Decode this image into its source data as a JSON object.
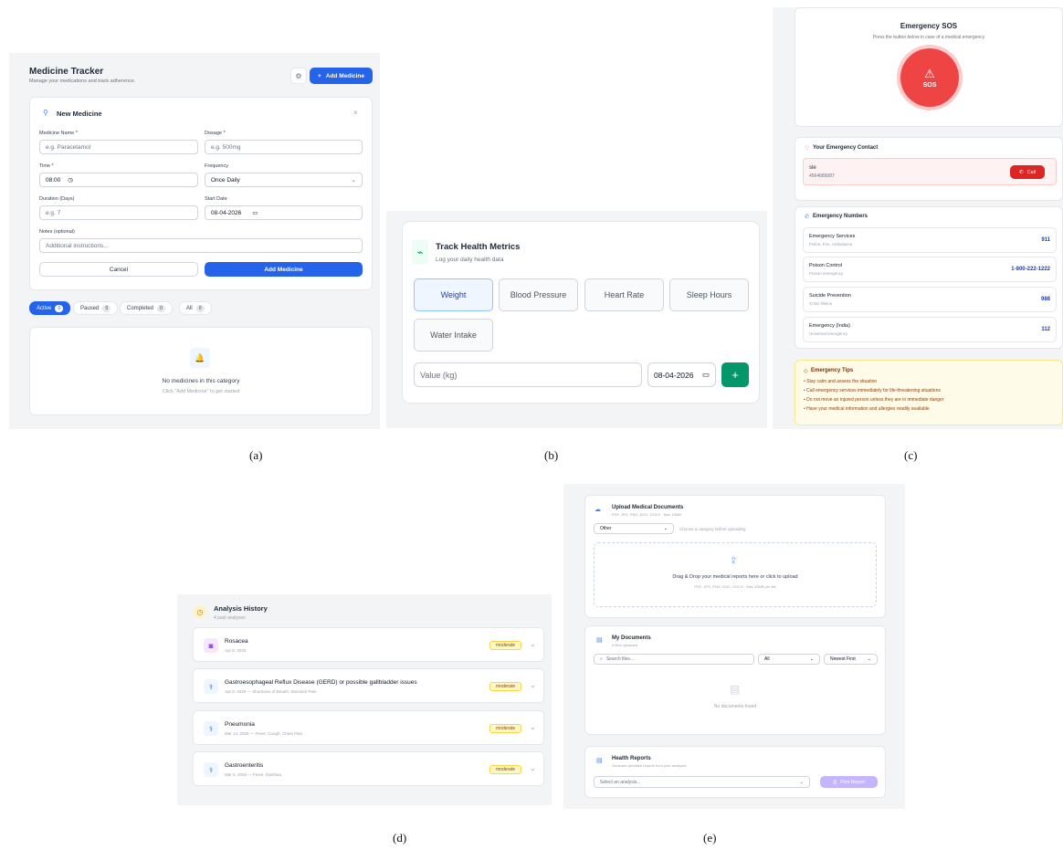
{
  "captions": [
    "(a)",
    "(b)",
    "(c)",
    "(d)",
    "(e)"
  ],
  "medicine": {
    "title": "Medicine Tracker",
    "subtitle": "Manage your medications and track adherence.",
    "add_button": "Add Medicine",
    "form": {
      "title": "New Medicine",
      "name_label": "Medicine Name *",
      "name_placeholder": "e.g. Paracetamol",
      "dosage_label": "Dosage *",
      "dosage_placeholder": "e.g. 500mg",
      "time_label": "Time *",
      "time_value": "08:00",
      "frequency_label": "Frequency",
      "frequency_value": "Once Daily",
      "duration_label": "Duration (Days)",
      "duration_placeholder": "e.g. 7",
      "start_label": "Start Date",
      "start_value": "08-04-2026",
      "notes_label": "Notes (optional)",
      "notes_placeholder": "Additional instructions...",
      "cancel": "Cancel",
      "submit": "Add Medicine"
    },
    "filters": [
      {
        "label": "Active",
        "count": "0"
      },
      {
        "label": "Paused",
        "count": "0"
      },
      {
        "label": "Completed",
        "count": "0"
      },
      {
        "label": "All",
        "count": "0"
      }
    ],
    "empty_title": "No medicines in this category",
    "empty_sub": "Click \"Add Medicine\" to get started"
  },
  "health": {
    "title": "Track Health Metrics",
    "subtitle": "Log your daily health data",
    "metrics": [
      "Weight",
      "Blood Pressure",
      "Heart Rate",
      "Sleep Hours",
      "Water Intake"
    ],
    "value_placeholder": "Value (kg)",
    "date_value": "08-04-2026",
    "add_symbol": "+"
  },
  "emergency": {
    "sos_title": "Emergency SOS",
    "sos_sub": "Press the button below in case of a medical emergency",
    "sos_label": "SOS",
    "contact_title": "Your Emergency Contact",
    "contact_name": "sle",
    "contact_phone": "4564689087",
    "call_label": "Call",
    "numbers_title": "Emergency Numbers",
    "numbers": [
      {
        "name": "Emergency Services",
        "sub": "Police, Fire, Ambulance",
        "num": "911"
      },
      {
        "name": "Poison Control",
        "sub": "Poison emergency",
        "num": "1-800-222-1222"
      },
      {
        "name": "Suicide Prevention",
        "sub": "Crisis lifeline",
        "num": "988"
      },
      {
        "name": "Emergency (India)",
        "sub": "Universal emergency",
        "num": "112"
      }
    ],
    "tips_title": "Emergency Tips",
    "tips": [
      "Stay calm and assess the situation",
      "Call emergency services immediately for life-threatening situations",
      "Do not move an injured person unless they are in immediate danger",
      "Have your medical information and allergies readily available"
    ]
  },
  "history": {
    "title": "Analysis History",
    "sub": "4 past analyses",
    "items": [
      {
        "name": "Rosacea",
        "meta": "Apr 8, 2026",
        "badge": "moderate"
      },
      {
        "name": "Gastroesophageal Reflux Disease (GERD) or possible gallbladder issues",
        "meta": "Apr 8, 2026 — Shortness of Breath, Stomach Pain",
        "badge": "moderate"
      },
      {
        "name": "Pneumonia",
        "meta": "Mar 14, 2026 — Fever, Cough, Chest Pain",
        "badge": "moderate"
      },
      {
        "name": "Gastroenteritis",
        "meta": "Mar 5, 2026 — Fever, Diarrhea",
        "badge": "moderate"
      }
    ]
  },
  "docs": {
    "upload_title": "Upload Medical Documents",
    "upload_sub": "PDF, JPG, PNG, DOC, DOCX · Max 10MB",
    "category_value": "Other",
    "category_hint": "Choose a category before uploading",
    "drop_title": "Drag & Drop your medical reports here or click to upload",
    "drop_sub": "PDF, JPG, PNG, DOC, DOCX · Max 10MB per file",
    "my_title": "My Documents",
    "my_sub": "0 files uploaded",
    "search_placeholder": "Search files...",
    "filter_value": "All",
    "sort_value": "Newest First",
    "empty": "No documents found",
    "reports_title": "Health Reports",
    "reports_sub": "Generate printable reports from your analyses",
    "select_placeholder": "Select an analysis...",
    "print_label": "Print Report"
  }
}
